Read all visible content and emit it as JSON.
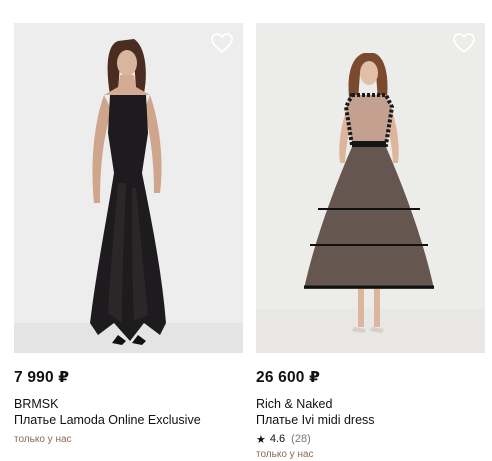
{
  "products": [
    {
      "price": "7 990 ₽",
      "brand": "BRMSK",
      "title": "Платье Lamoda Online Exclusive",
      "badge": "только у нас",
      "favorite_icon": "heart-outline-icon"
    },
    {
      "price": "26 600 ₽",
      "brand": "Rich & Naked",
      "title": "Платье Ivi midi dress",
      "rating_icon": "star-icon",
      "rating": "4.6",
      "reviews": "(28)",
      "badge": "только у нас",
      "favorite_icon": "heart-outline-icon"
    }
  ],
  "colors": {
    "badge_text": "#8b6a55",
    "photo_bg": "#ededed"
  }
}
